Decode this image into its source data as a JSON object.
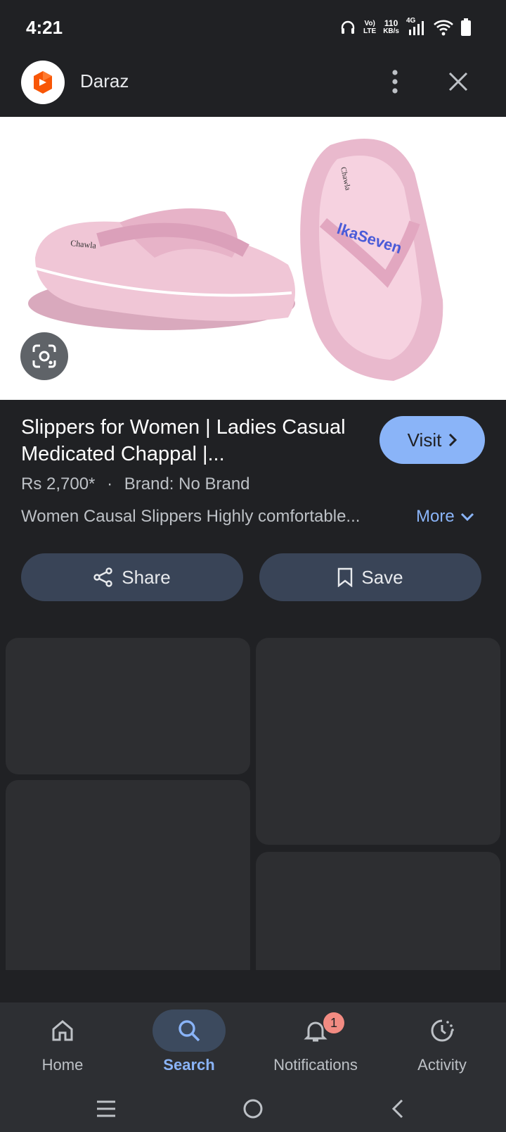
{
  "status_bar": {
    "time": "4:21",
    "volte_top": "Vo)",
    "volte_bottom": "LTE",
    "speed_value": "110",
    "speed_unit": "KB/s",
    "network": "4G"
  },
  "header": {
    "site_name": "Daraz",
    "logo_icon": "daraz-logo",
    "menu_icon": "more-vert-icon",
    "close_icon": "close-icon"
  },
  "product": {
    "title": "Slippers for Women | Ladies Casual Medicated Chappal |...",
    "visit_label": "Visit",
    "price": "Rs 2,700*",
    "separator": "·",
    "brand": "Brand: No Brand",
    "description": "Women Causal Slippers Highly comfortable...",
    "more_label": "More"
  },
  "actions": {
    "share_label": "Share",
    "save_label": "Save"
  },
  "bottom_nav": {
    "items": [
      {
        "label": "Home",
        "icon": "home-icon"
      },
      {
        "label": "Search",
        "icon": "search-icon"
      },
      {
        "label": "Notifications",
        "icon": "bell-icon",
        "badge": "1"
      },
      {
        "label": "Activity",
        "icon": "history-icon"
      }
    ]
  },
  "colors": {
    "background": "#202124",
    "accent": "#8ab4f8",
    "pill": "#394457",
    "badge": "#f28b82"
  }
}
